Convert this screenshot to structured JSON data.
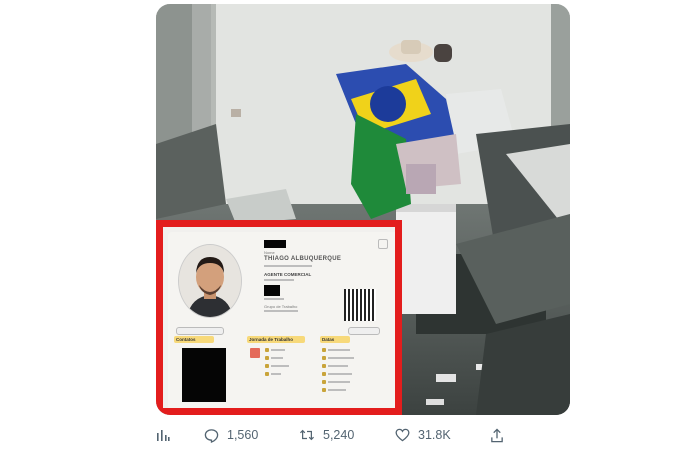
{
  "tweet": {
    "overlay_card": {
      "header_label": "Nome",
      "name": "THIAGO ALBUQUERQUE",
      "role": "AGENTE COMERCIAL",
      "group_label": "Grupo de Trabalho",
      "sections": {
        "contacts": "Contatos",
        "work_hours": "Jornada de Trabalho",
        "dates": "Datas"
      }
    },
    "actions": {
      "analytics_icon": "bar-chart-icon",
      "replies": "1,560",
      "retweets": "5,240",
      "likes": "31.8K",
      "share_icon": "share-icon"
    }
  }
}
